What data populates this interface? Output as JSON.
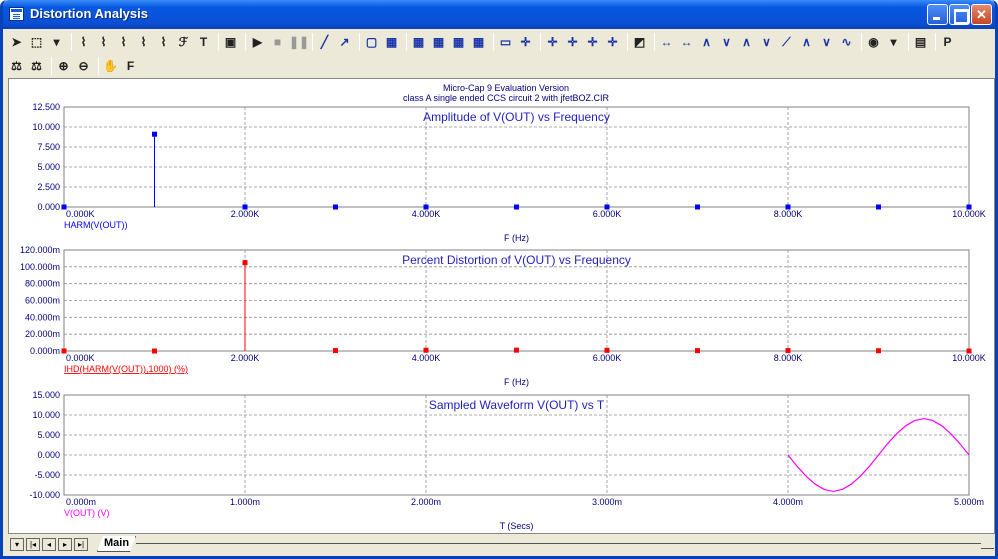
{
  "window": {
    "title": "Distortion Analysis"
  },
  "toolbar1": [
    "select-arrow-icon",
    "zoom-box-icon",
    "dropdown-icon",
    "sep",
    "graph-icon",
    "graph-icon",
    "graph-icon",
    "graph-icon",
    "graph-icon",
    "fourier-icon",
    "text-icon",
    "sep",
    "properties-icon",
    "sep",
    "run-icon",
    "stop-icon",
    "pause-icon",
    "sep",
    "line-icon",
    "arrow-line-icon",
    "sep",
    "frame-icon",
    "grid-icon",
    "sep",
    "grid-icon",
    "grid-icon",
    "grid-icon",
    "grid-icon",
    "sep",
    "horizontal-line-icon",
    "cursor-icon",
    "sep",
    "cursor-icon",
    "cursor-icon",
    "cursor-icon",
    "cursor-icon",
    "sep",
    "color-icon",
    "sep",
    "cursor-mode-icon",
    "cursor-mode-icon",
    "peak-icon",
    "valley-icon",
    "peak-icon",
    "valley-icon",
    "slope-icon",
    "peak-icon",
    "valley-icon",
    "inflection-icon",
    "sep",
    "camera-icon",
    "dropdown-icon",
    "sep",
    "table-icon",
    "sep",
    "p-icon"
  ],
  "toolbar2": [
    "scale-icon",
    "scale-icon",
    "sep",
    "zoom-in-icon",
    "zoom-out-icon",
    "sep",
    "pan-icon",
    "font-icon"
  ],
  "header": {
    "line1": "Micro-Cap 9 Evaluation Version",
    "line2": "class A single ended CCS circuit 2 with jfetBOZ.CIR"
  },
  "x_axis_freq": {
    "ticks": [
      "0.000K",
      "2.000K",
      "4.000K",
      "6.000K",
      "8.000K",
      "10.000K"
    ],
    "label": "F (Hz)"
  },
  "x_axis_time": {
    "ticks": [
      "0.000m",
      "1.000m",
      "2.000m",
      "3.000m",
      "4.000m",
      "5.000m"
    ],
    "label": "T (Secs)"
  },
  "chart_data": [
    {
      "type": "bar",
      "title": "Amplitude of V(OUT) vs Frequency",
      "xlabel": "F (Hz)",
      "series": [
        {
          "name": "HARM(V(OUT))",
          "x": [
            0,
            1000,
            2000,
            3000,
            4000,
            5000,
            6000,
            7000,
            8000,
            9000,
            10000
          ],
          "values": [
            0,
            9.1,
            0,
            0,
            0,
            0,
            0,
            0,
            0,
            0,
            0
          ]
        }
      ],
      "ylim": [
        0,
        12.5
      ],
      "y_ticks": [
        "12.500",
        "10.000",
        "7.500",
        "5.000",
        "2.500",
        "0.000"
      ],
      "xlim": [
        0,
        10000
      ],
      "grid": true,
      "color": "#0000ff"
    },
    {
      "type": "bar",
      "title": "Percent Distortion of V(OUT) vs Frequency",
      "xlabel": "F (Hz)",
      "series": [
        {
          "name": "IHD(HARM(V(OUT)),1000) (%)",
          "x": [
            0,
            1000,
            2000,
            3000,
            4000,
            5000,
            6000,
            7000,
            8000,
            9000,
            10000
          ],
          "values": [
            0,
            0,
            105,
            0.5,
            0.9,
            1.0,
            0.8,
            0.4,
            0.5,
            0.3,
            0
          ]
        }
      ],
      "ylim": [
        0,
        120
      ],
      "y_ticks": [
        "120.000m",
        "100.000m",
        "80.000m",
        "60.000m",
        "40.000m",
        "20.000m",
        "0.000m"
      ],
      "xlim": [
        0,
        10000
      ],
      "grid": true,
      "color": "#ff0000"
    },
    {
      "type": "line",
      "title": "Sampled Waveform  V(OUT) vs T",
      "xlabel": "T (Secs)",
      "series": [
        {
          "name": "V(OUT) (V)",
          "x": [
            4.0,
            4.05,
            4.1,
            4.15,
            4.2,
            4.25,
            4.3,
            4.35,
            4.4,
            4.45,
            4.5,
            4.55,
            4.6,
            4.65,
            4.7,
            4.75,
            4.8,
            4.85,
            4.9,
            4.95,
            5.0
          ],
          "values": [
            0,
            -2.8,
            -5.3,
            -7.3,
            -8.6,
            -9.1,
            -8.6,
            -7.3,
            -5.3,
            -2.8,
            0,
            2.8,
            5.3,
            7.3,
            8.6,
            9.1,
            8.6,
            7.3,
            5.3,
            2.8,
            0
          ]
        }
      ],
      "ylim": [
        -10,
        15
      ],
      "y_ticks": [
        "15.000",
        "10.000",
        "5.000",
        "0.000",
        "-5.000",
        "-10.000"
      ],
      "xlim": [
        0,
        5
      ],
      "grid": true,
      "color": "#ff00ff"
    }
  ],
  "bottom": {
    "tab": "Main"
  }
}
